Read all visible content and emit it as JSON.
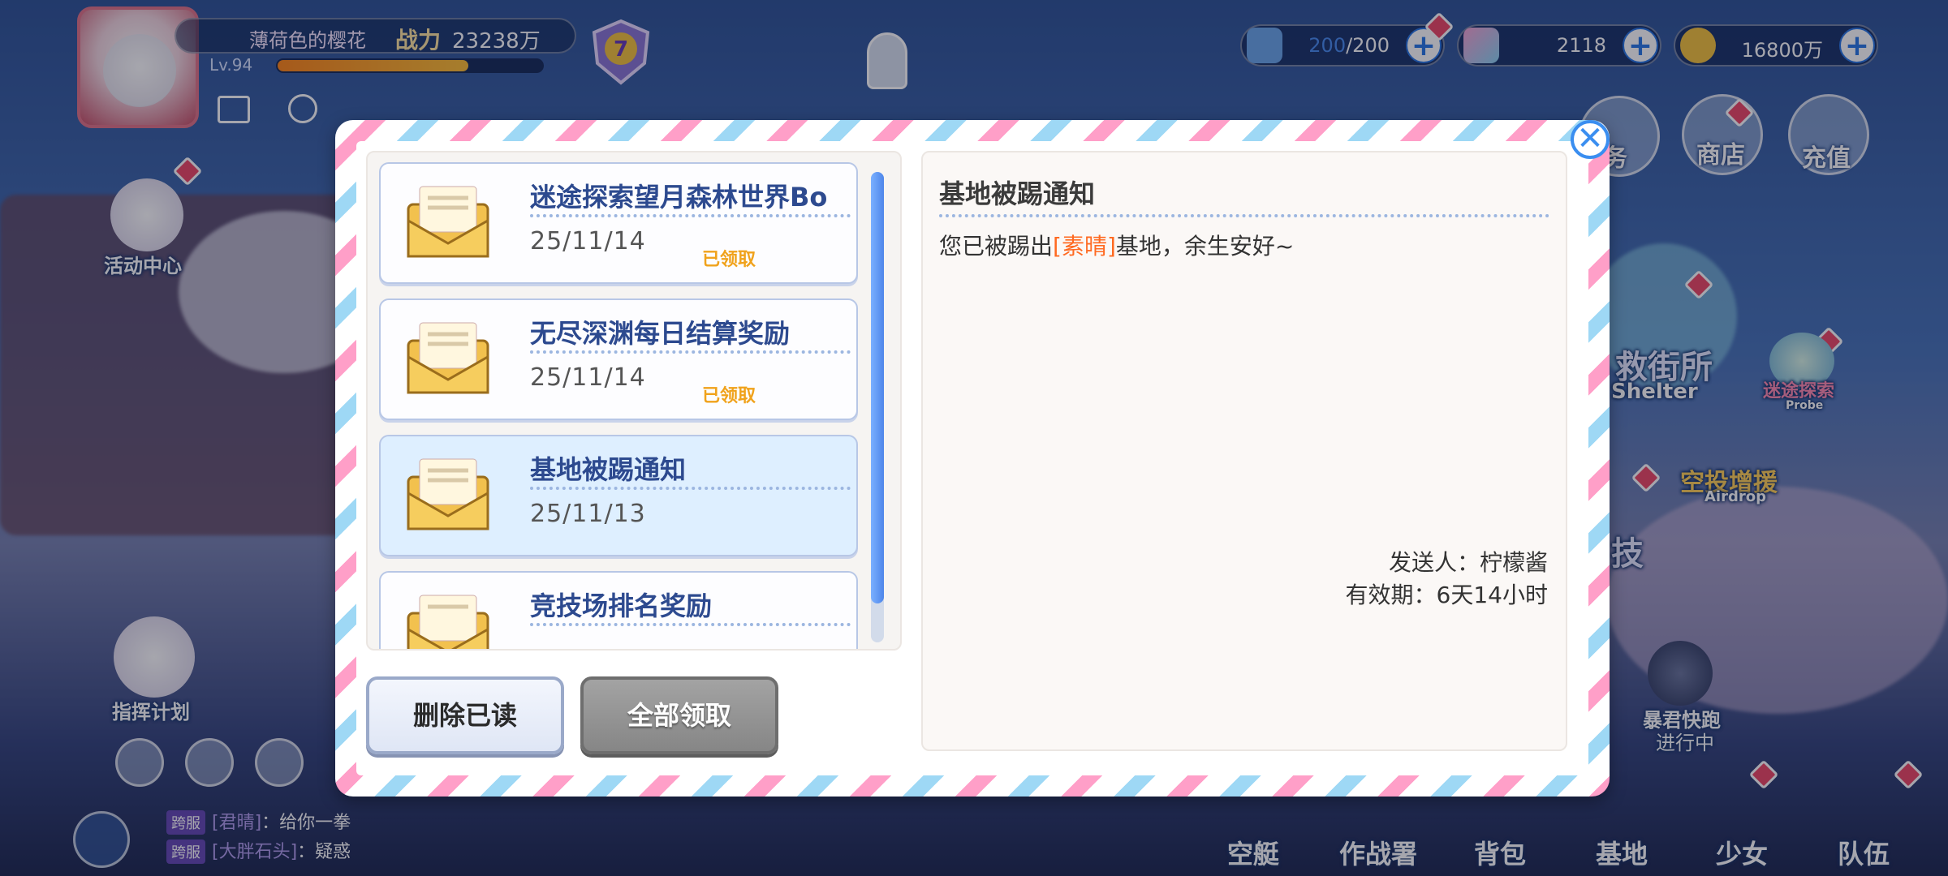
{
  "player": {
    "name": "薄荷色的樱花",
    "power_label": "战力",
    "power_value": "23238万",
    "level": "Lv.94",
    "exp_fraction": 0.72,
    "rank": "7"
  },
  "resources": [
    {
      "icon": "stamina-icon",
      "current": "200",
      "max": "/200"
    },
    {
      "icon": "crystal-icon",
      "value": "2118"
    },
    {
      "icon": "coin-icon",
      "value": "16800万"
    }
  ],
  "top_menu": {
    "task": "务",
    "shop": "商店",
    "recharge": "充值"
  },
  "side": {
    "activity": "活动中心",
    "command": "指挥计划",
    "shelter": "救街所",
    "shelter_en": "Shelter",
    "probe": "迷途探索",
    "probe_en": "Probe",
    "airdrop": "空投增援",
    "airdrop_en": "Airdrop",
    "arena": "技",
    "tyrant_run": "暴君快跑",
    "tyrant_status": "进行中"
  },
  "chat": [
    {
      "tag": "跨服",
      "who": "[君晴]",
      "msg": "：给你一拳"
    },
    {
      "tag": "跨服",
      "who": "[大胖石头]",
      "msg": "：疑惑"
    }
  ],
  "bottom_nav": [
    "空艇",
    "作战署",
    "背包",
    "基地",
    "少女",
    "队伍"
  ],
  "mail": {
    "items": [
      {
        "title": "迷途探索望月森林世界Bo",
        "date": "25/11/14",
        "status": "已领取"
      },
      {
        "title": "无尽深渊每日结算奖励",
        "date": "25/11/14",
        "status": "已领取"
      },
      {
        "title": "基地被踢通知",
        "date": "25/11/13",
        "status": ""
      },
      {
        "title": "竞技场排名奖励",
        "date": "",
        "status": ""
      }
    ],
    "detail": {
      "title": "基地被踢通知",
      "body_pre": "您已被踢出",
      "body_highlight": "[素晴]",
      "body_post": "基地，余生安好~",
      "sender": "发送人：柠檬酱",
      "expire": "有效期：6天14小时"
    },
    "buttons": {
      "delete_read": "删除已读",
      "claim_all": "全部领取"
    },
    "close": "✕"
  },
  "colors": {
    "accent": "#3a8ef0",
    "highlight": "#ff6a21",
    "claimed": "#f0a21b"
  }
}
